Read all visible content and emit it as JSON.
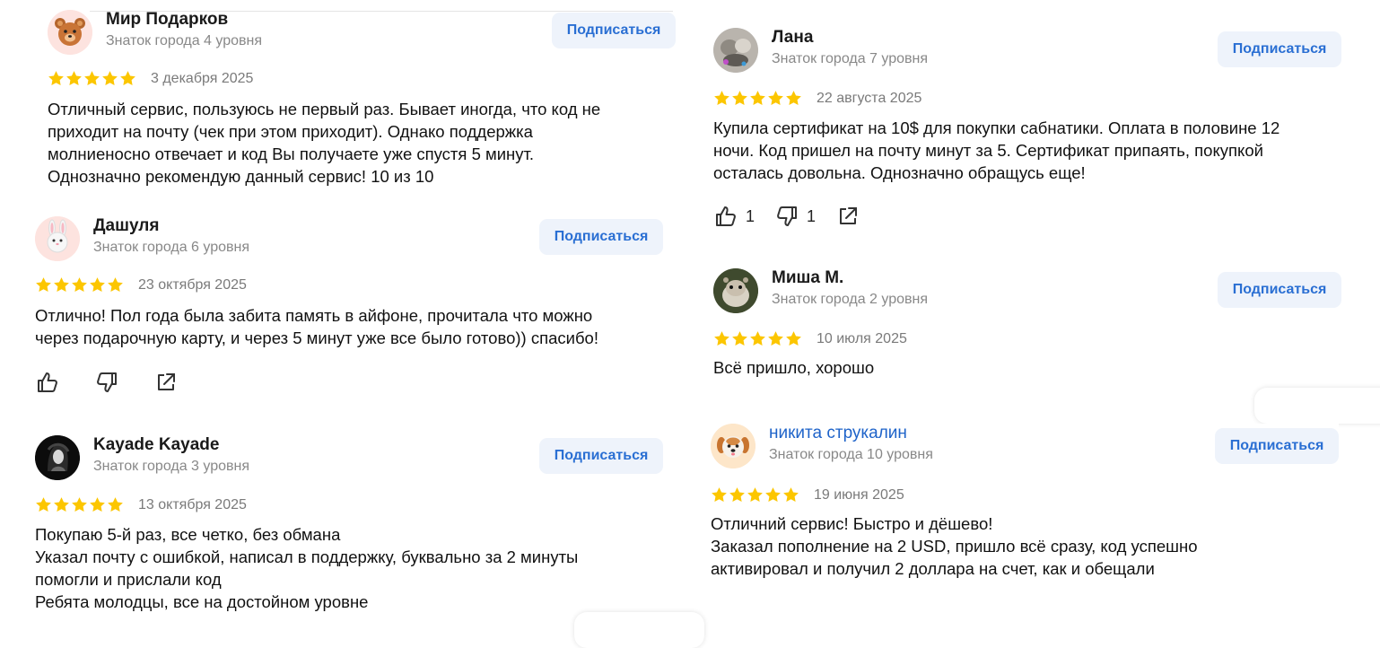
{
  "subscribe_label": "Подписаться",
  "reviews": [
    {
      "author": "Мир Подарков",
      "level": "Знаток города 4 уровня",
      "avatar_icon": "bear-emoji-icon",
      "stars": 5,
      "date": "3 декабря 2025",
      "text": [
        "Отличный сервис, пользуюсь не первый раз. Бывает иногда, что код не",
        "приходит на почту (чек при этом приходит). Однако поддержка",
        "молниеносно отвечает и код Вы получаете уже спустя 5 минут.",
        "Однозначно рекомендую данный сервис! 10 из 10"
      ]
    },
    {
      "author": "Дашуля",
      "level": "Знаток города 6 уровня",
      "avatar_icon": "bunny-emoji-icon",
      "stars": 5,
      "date": "23 октября 2025",
      "text": [
        "Отлично! Пол года была забита память в айфоне, прочитала что можно",
        "через подарочную карту, и через 5 минут уже все было готово)) спасибо!"
      ],
      "likes": "",
      "dislikes": ""
    },
    {
      "author": "Kayade Kayade",
      "level": "Знаток города 3 уровня",
      "avatar_icon": "dark-portrait-avatar",
      "stars": 5,
      "date": "13 октября 2025",
      "text": [
        "Покупаю 5-й раз, все четко, без обмана",
        "Указал почту с ошибкой, написал в поддержку, буквально за 2 минуты",
        "помогли и прислали код",
        "Ребята молодцы, все на достойном уровне"
      ]
    },
    {
      "author": "Лана",
      "level": "Знаток города 7 уровня",
      "avatar_icon": "photo-avatar",
      "stars": 5,
      "date": "22 августа 2025",
      "text": [
        "Купила сертификат на 10$ для покупки сабнатики. Оплата в половине 12",
        "ночи. Код пришел на почту минут за 5. Сертификат припаять, покупкой",
        "осталась довольна. Однозначно обращусь еще!"
      ],
      "likes": "1",
      "dislikes": "1"
    },
    {
      "author": "Миша М.",
      "level": "Знаток города 2 уровня",
      "avatar_icon": "hamster-photo-avatar",
      "stars": 5,
      "date": "10 июля 2025",
      "text": [
        "Всё пришло, хорошо"
      ]
    },
    {
      "author": "никита струкалин",
      "level": "Знаток города 10 уровня",
      "avatar_icon": "dog-emoji-icon",
      "stars": 5,
      "date": "19 июня 2025",
      "text": [
        "Отличний сервис! Быстро и дёшево!",
        "Заказал пополнение на 2 USD, пришло всё сразу, код успешно",
        "активировал и получил 2 доллара на счет, как и обещали"
      ]
    }
  ],
  "colors": {
    "star": "#fcc600",
    "subscribe_bg": "#eef3fb",
    "subscribe_text": "#2a6fd3",
    "author_link": "#1e63c9",
    "meta_gray": "#888888"
  }
}
